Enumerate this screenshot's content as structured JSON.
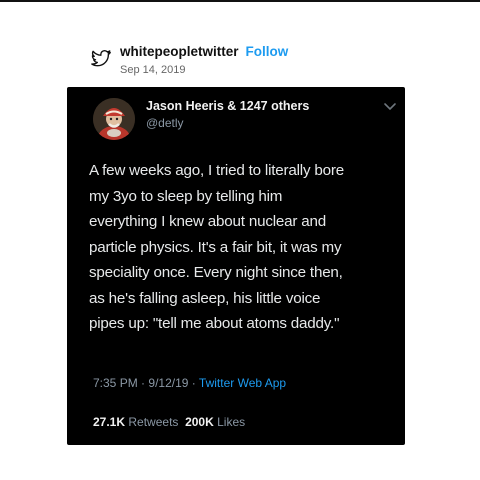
{
  "repost": {
    "icon": "twitter-bird-outline-icon",
    "account": "whitepeopletwitter",
    "follow_label": "Follow",
    "date": "Sep 14, 2019",
    "accent_color": "#1d9bf0"
  },
  "tweet": {
    "display_name": "Jason Heeris & 1247 others",
    "handle": "@detly",
    "avatar_icon": "wizard-avatar",
    "menu_icon": "chevron-down-icon",
    "text_lines": [
      "A few weeks ago, I tried to literally bore",
      "my 3yo to sleep by telling him",
      "everything I knew about nuclear and",
      "particle physics. It's a fair bit, it was my",
      "speciality once. Every night since then,",
      "as he's falling asleep, his little voice",
      "pipes up: \"tell me about atoms daddy.\""
    ],
    "time": "7:35 PM",
    "date": "9/12/19",
    "separator": "·",
    "source": "Twitter Web App",
    "retweet_count": "27.1K",
    "retweet_label": "Retweets",
    "like_count": "200K",
    "like_label": "Likes",
    "background": "#000000"
  }
}
